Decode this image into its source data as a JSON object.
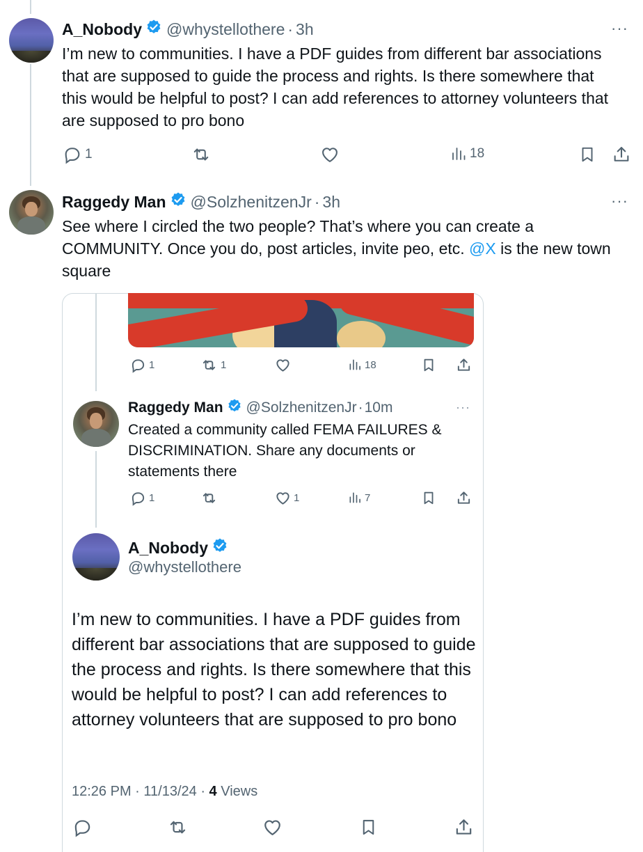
{
  "tweet1": {
    "name": "A_Nobody",
    "handle": "@whystellothere",
    "time": "3h",
    "text": "I’m new to communities. I have a PDF guides from different bar associations that are supposed to guide the process and rights. Is there somewhere that this would be helpful to post? I can add references to attorney volunteers that are supposed to pro bono",
    "replies": "1",
    "views": "18"
  },
  "tweet2": {
    "name": "Raggedy Man",
    "handle": "@SolzhenitzenJr",
    "time": "3h",
    "text_before": "See where I circled the two people?  That’s where you can create a COMMUNITY.  Once you do, post articles, invite peo, etc.  ",
    "mention": "@X",
    "text_after": " is the new town square"
  },
  "quote": {
    "media_actions": {
      "replies": "1",
      "reposts": "1",
      "views": "18"
    },
    "reply": {
      "name": "Raggedy Man",
      "handle": "@SolzhenitzenJr",
      "time": "10m",
      "text": "Created a community called FEMA FAILURES & DISCRIMINATION.  Share any documents or statements there",
      "replies": "1",
      "likes": "1",
      "views": "7"
    },
    "main": {
      "name": "A_Nobody",
      "handle": "@whystellothere",
      "text": "I’m new to communities. I have a PDF guides from different bar associations that are supposed to guide the process and rights. Is there somewhere that this would be helpful to post? I can add references to attorney volunteers that are supposed to pro bono",
      "time": "12:26 PM",
      "date": "11/13/24",
      "views_count": "4",
      "views_label": "Views"
    }
  },
  "colors": {
    "accent": "#1d9bf0",
    "muted": "#536471",
    "text": "#0f1419",
    "border": "#cfd9de"
  }
}
